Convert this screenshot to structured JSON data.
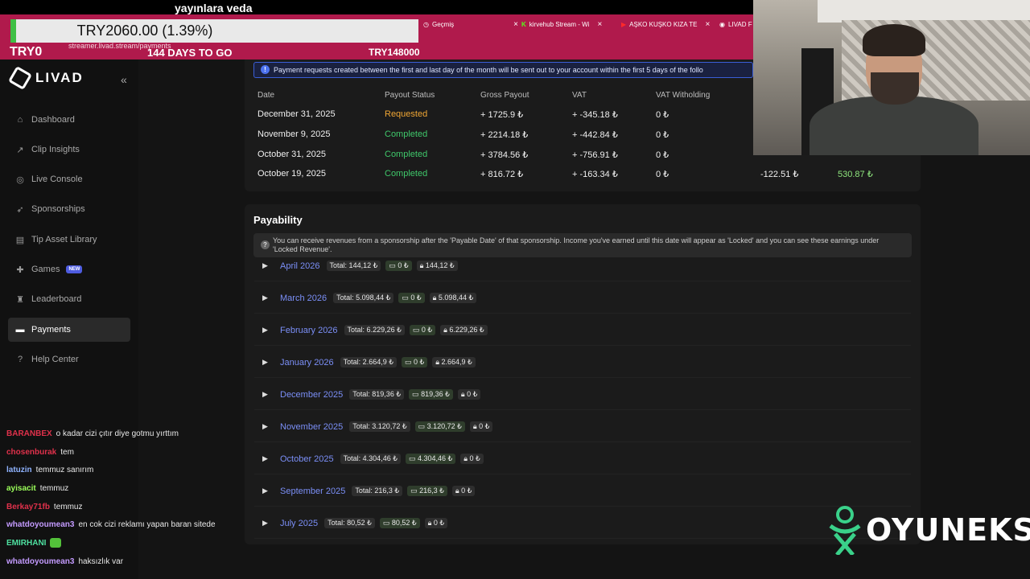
{
  "stream": {
    "title": "yayınlara veda",
    "ticker": "TRY2060.00 (1.39%)",
    "try_left": "TRY0",
    "days_left": "144 DAYS TO GO",
    "try_right": "TRY148000"
  },
  "browser": {
    "url": "streamer.livad.stream/payments",
    "tabs": [
      {
        "label": "Geçmiş",
        "icon": "history-icon"
      },
      {
        "label": "kirvehub Stream - Wi",
        "icon": "kick-icon"
      },
      {
        "label": "AŞKO KUŞKO KIZA TE",
        "icon": "youtube-icon"
      },
      {
        "label": "LIVAD F",
        "icon": "globe-icon"
      }
    ]
  },
  "sidebar": {
    "logo": "LIVAD",
    "collapse_icon": "double-chevron-left-icon",
    "items": [
      {
        "label": "Dashboard",
        "icon": "home-icon"
      },
      {
        "label": "Clip Insights",
        "icon": "chart-icon"
      },
      {
        "label": "Live Console",
        "icon": "broadcast-icon"
      },
      {
        "label": "Sponsorships",
        "icon": "rocket-icon"
      },
      {
        "label": "Tip Asset Library",
        "icon": "library-icon"
      },
      {
        "label": "Games",
        "icon": "gamepad-icon",
        "badge": "NEW"
      },
      {
        "label": "Leaderboard",
        "icon": "trophy-icon"
      },
      {
        "label": "Payments",
        "icon": "card-icon",
        "active": true
      },
      {
        "label": "Help Center",
        "icon": "question-icon"
      }
    ]
  },
  "chat": [
    {
      "user": "BARANBEX",
      "color": "#e0314b",
      "msg": "o kadar cizi çıtır diye gotmu yırttım"
    },
    {
      "user": "chosenburak",
      "color": "#e0314b",
      "msg": "tem"
    },
    {
      "user": "latuzin",
      "color": "#8fb3ff",
      "msg": "temmuz sanırım"
    },
    {
      "user": "ayisacit",
      "color": "#9bff5a",
      "msg": "temmuz"
    },
    {
      "user": "Berkay71fb",
      "color": "#e0314b",
      "msg": "temmuz"
    },
    {
      "user": "whatdoyoumean3",
      "color": "#c49bff",
      "msg": "en cok cizi reklamı yapan baran sitede"
    },
    {
      "user": "EMIRHANI",
      "color": "#4ee0a0",
      "msg": ""
    },
    {
      "user": "whatdoyoumean3",
      "color": "#c49bff",
      "msg": "haksızlık var"
    }
  ],
  "payouts": {
    "banner": "Payment requests created between the first and last day of the month will be sent out to your account within the first 5 days of the follo",
    "headers": [
      "Date",
      "Payout Status",
      "Gross Payout",
      "VAT",
      "VAT Witholding"
    ],
    "rows": [
      {
        "date": "December 31, 2025",
        "status": "Requested",
        "status_color": "#f0a634",
        "gross": "+ 1725.9 ₺",
        "vat": "+ -345.18 ₺",
        "withholding": "0 ₺",
        "extra1": "",
        "extra2": ""
      },
      {
        "date": "November 9, 2025",
        "status": "Completed",
        "status_color": "#3fc76a",
        "gross": "+ 2214.18 ₺",
        "vat": "+ -442.84 ₺",
        "withholding": "0 ₺",
        "extra1": "",
        "extra2": ""
      },
      {
        "date": "October 31, 2025",
        "status": "Completed",
        "status_color": "#3fc76a",
        "gross": "+ 3784.56 ₺",
        "vat": "+ -756.91 ₺",
        "withholding": "0 ₺",
        "extra1": "",
        "extra2": ""
      },
      {
        "date": "October 19, 2025",
        "status": "Completed",
        "status_color": "#3fc76a",
        "gross": "+ 816.72 ₺",
        "vat": "+ -163.34 ₺",
        "withholding": "0 ₺",
        "extra1": "-122.51 ₺",
        "extra2": "530.87 ₺"
      }
    ]
  },
  "payability": {
    "title": "Payability",
    "note": "You can receive revenues from a sponsorship after the 'Payable Date' of that sponsorship. Income you've earned until this date will appear as 'Locked' and you can see these earnings under 'Locked Revenue'.",
    "months": [
      {
        "name": "April 2026",
        "total": "Total: 144,12 ₺",
        "payable": "0 ₺",
        "locked": "144,12 ₺"
      },
      {
        "name": "March 2026",
        "total": "Total: 5.098,44 ₺",
        "payable": "0 ₺",
        "locked": "5.098,44 ₺"
      },
      {
        "name": "February 2026",
        "total": "Total: 6.229,26 ₺",
        "payable": "0 ₺",
        "locked": "6.229,26 ₺"
      },
      {
        "name": "January 2026",
        "total": "Total: 2.664,9 ₺",
        "payable": "0 ₺",
        "locked": "2.664,9 ₺"
      },
      {
        "name": "December 2025",
        "total": "Total: 819,36 ₺",
        "payable": "819,36 ₺",
        "locked": "0 ₺"
      },
      {
        "name": "November 2025",
        "total": "Total: 3.120,72 ₺",
        "payable": "3.120,72 ₺",
        "locked": "0 ₺"
      },
      {
        "name": "October 2025",
        "total": "Total: 4.304,46 ₺",
        "payable": "4.304,46 ₺",
        "locked": "0 ₺"
      },
      {
        "name": "September 2025",
        "total": "Total: 216,3 ₺",
        "payable": "216,3 ₺",
        "locked": "0 ₺"
      },
      {
        "name": "July 2025",
        "total": "Total: 80,52 ₺",
        "payable": "80,52 ₺",
        "locked": "0 ₺"
      }
    ]
  },
  "brand": {
    "text": "OYUNEKS"
  }
}
